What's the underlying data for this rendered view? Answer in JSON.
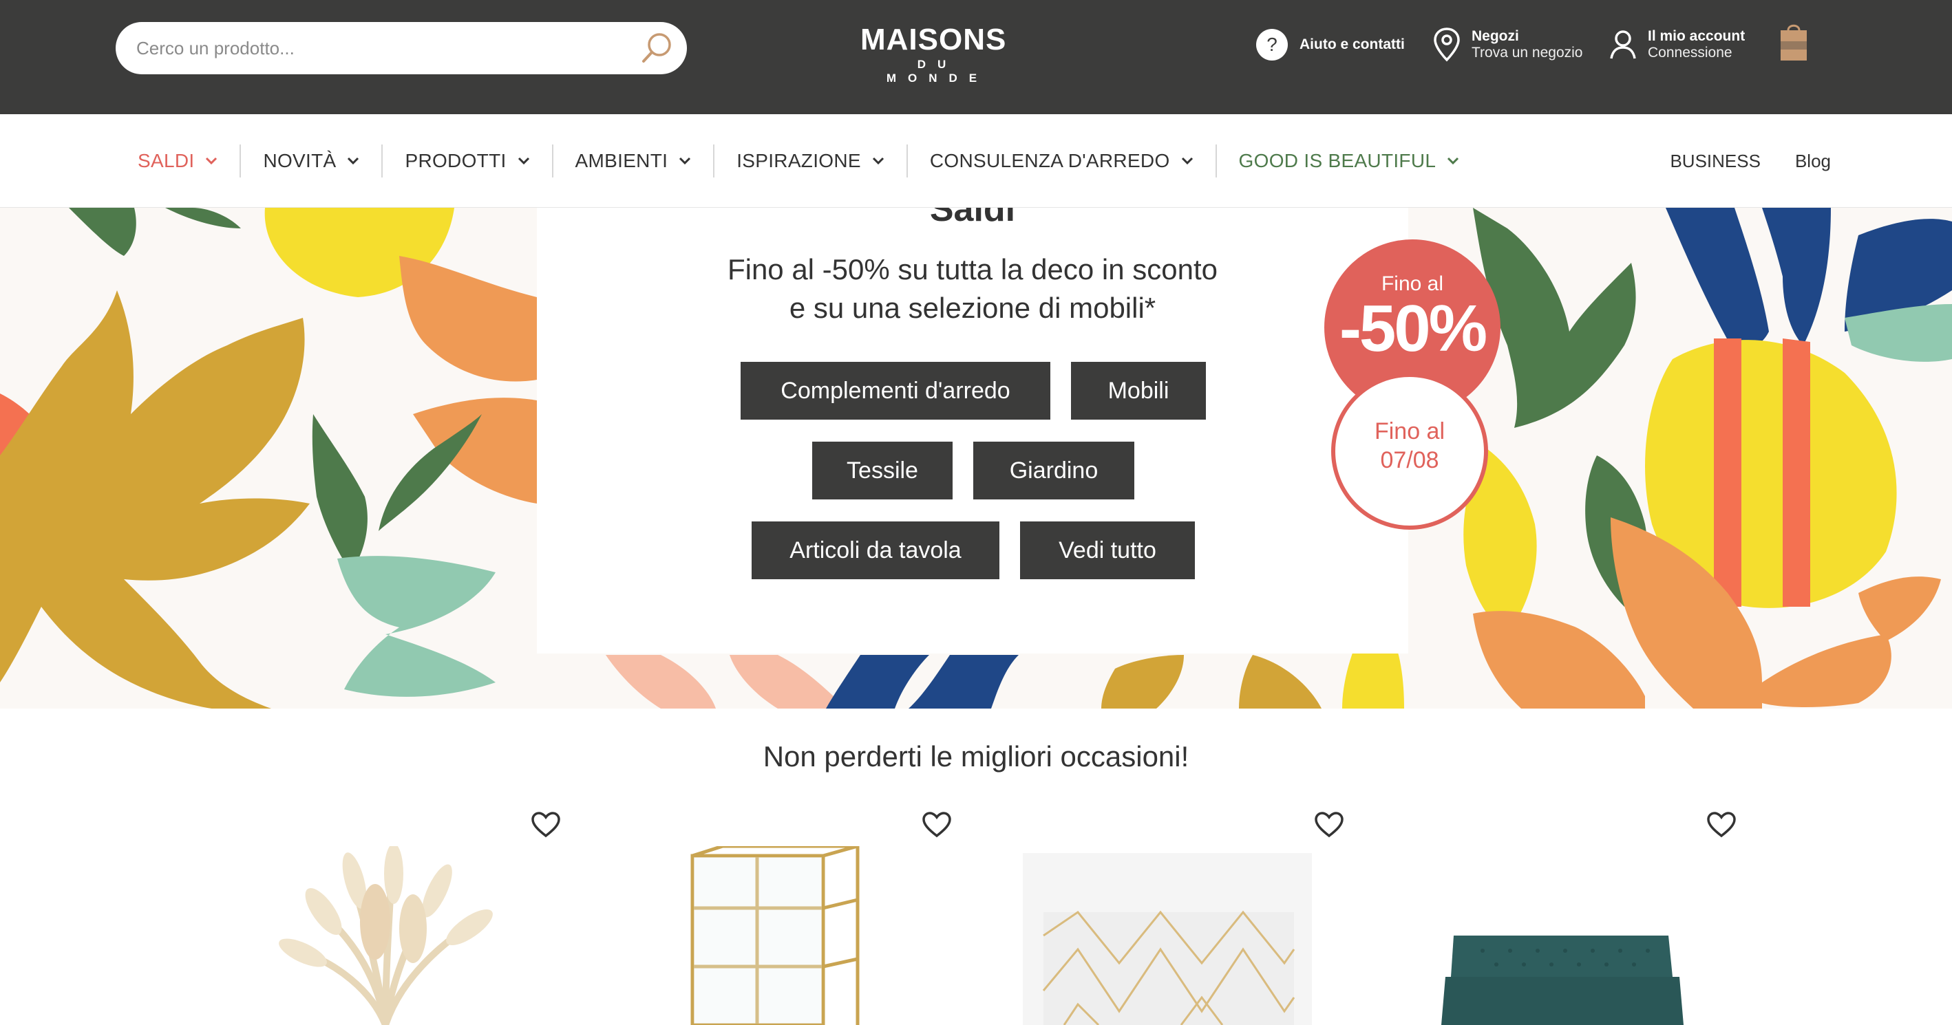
{
  "header": {
    "search_placeholder": "Cerco un prodotto...",
    "logo_line1": "MAISONS",
    "logo_line2": "DU MONDE",
    "help_label": "Aiuto e contatti",
    "stores_title": "Negozi",
    "stores_sub": "Trova un negozio",
    "account_title": "Il mio account",
    "account_sub": "Connessione",
    "cart_label": "cart-icon"
  },
  "nav": {
    "items": [
      "SALDI",
      "NOVITÀ",
      "PRODOTTI",
      "AMBIENTI",
      "ISPIRAZIONE",
      "CONSULENZA D'ARREDO",
      "GOOD IS BEAUTIFUL"
    ],
    "right": [
      "BUSINESS",
      "Blog"
    ],
    "colors": {
      "saldi": "#e0625b",
      "good": "#4e7a4b",
      "default": "#333333"
    }
  },
  "hero": {
    "cut_title": "Saldi",
    "subtitle_line1": "Fino al -50% su tutta la deco in sconto",
    "subtitle_line2": "e su una selezione di mobili*",
    "buttons": [
      "Complementi d'arredo",
      "Mobili",
      "Tessile",
      "Giardino",
      "Articoli da tavola",
      "Vedi tutto"
    ],
    "badge_top": "Fino al",
    "badge_value": "-50%",
    "badge_date_label": "Fino al 07/08"
  },
  "section": {
    "title": "Non perderti le migliori occasioni!"
  },
  "colors": {
    "topbar": "#3c3c3b",
    "button": "#3c3c3b",
    "accent": "#e0625b"
  }
}
